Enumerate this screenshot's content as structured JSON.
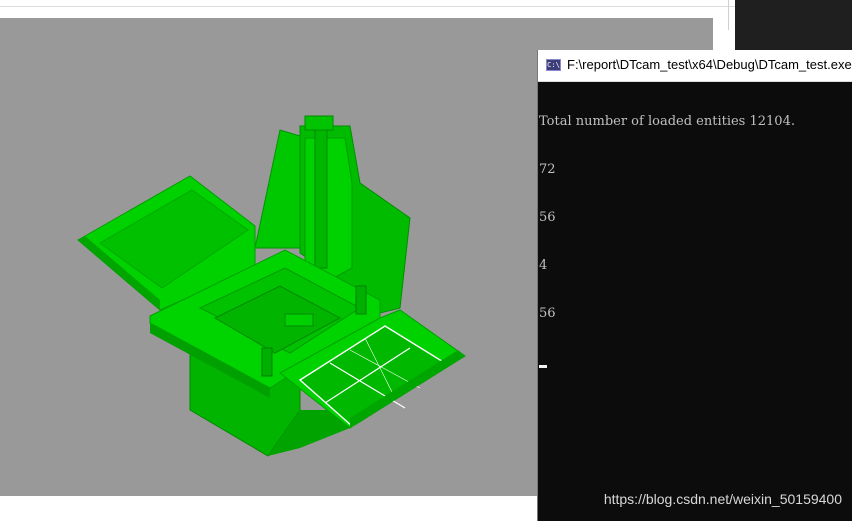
{
  "console": {
    "title": "F:\\report\\DTcam_test\\x64\\Debug\\DTcam_test.exe",
    "icon": "console-app-icon",
    "lines": [
      "Total number of loaded entities 12104.",
      "72",
      "56",
      "4",
      "56"
    ]
  },
  "viewer": {
    "background_color": "#999999",
    "model_color": "#00cc00",
    "highlight_color": "#ffffff"
  },
  "watermark": "https://blog.csdn.net/weixin_50159400"
}
